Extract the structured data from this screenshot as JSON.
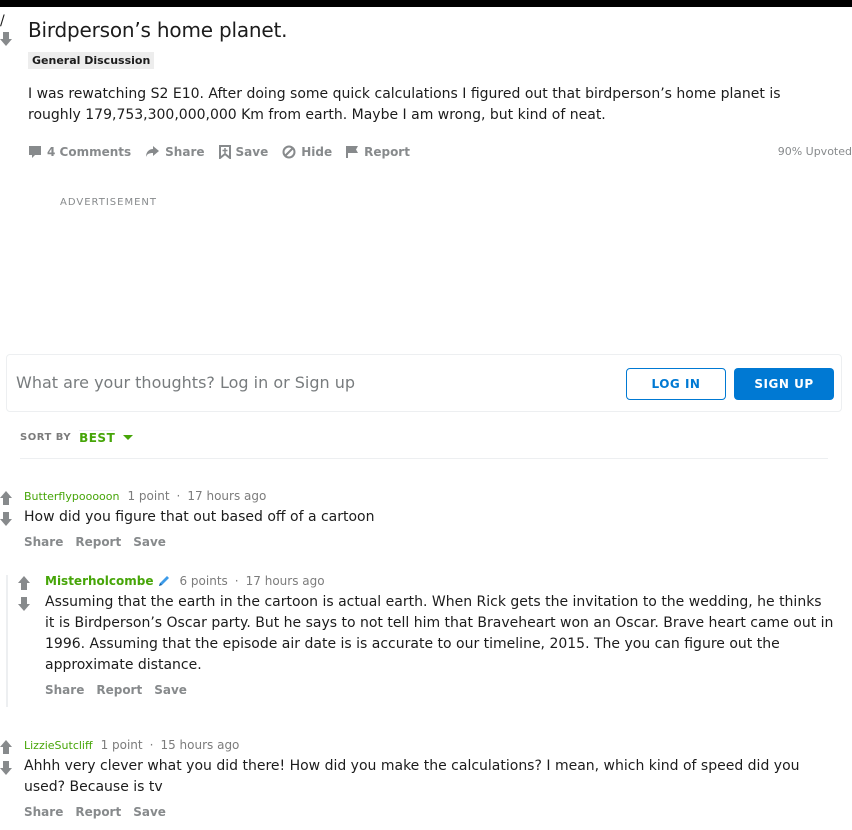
{
  "post": {
    "title": "Birdperson’s home planet.",
    "flair": "General Discussion",
    "body": "I was rewatching S2 E10. After doing some quick calculations I figured out that birdperson’s home planet is roughly 179,753,300,000,000 Km from earth. Maybe I am wrong, but kind of neat.",
    "actions": {
      "comments": "4 Comments",
      "share": "Share",
      "save": "Save",
      "hide": "Hide",
      "report": "Report"
    },
    "upvoted": "90% Upvoted"
  },
  "ad_label": "ADVERTISEMENT",
  "comment_box": {
    "placeholder": "What are your thoughts? Log in or Sign up",
    "login_label": "LOG IN",
    "signup_label": "SIGN UP"
  },
  "sort": {
    "label": "SORT BY",
    "value": "BEST"
  },
  "comments": [
    {
      "author": "Butterflypooooon",
      "points": "1 point",
      "time": "17 hours ago",
      "text": "How did you figure that out based off of a cartoon",
      "actions": [
        "Share",
        "Report",
        "Save"
      ]
    },
    {
      "author": "Misterholcombe",
      "points": "6 points",
      "time": "17 hours ago",
      "text": "Assuming that the earth in the cartoon is actual earth. When Rick gets the invitation to the wedding, he thinks it is Birdperson’s Oscar party. But he says to not tell him that Braveheart won an Oscar. Brave heart came out in 1996. Assuming that the episode air date is is accurate to our timeline, 2015. The you can figure out the approximate distance.",
      "actions": [
        "Share",
        "Report",
        "Save"
      ]
    },
    {
      "author": "LizzieSutcliff",
      "points": "1 point",
      "time": "15 hours ago",
      "text": "Ahhh very clever what you did there! How did you make the calculations? I mean, which kind of speed did you used? Because is tv",
      "actions": [
        "Share",
        "Report",
        "Save"
      ]
    }
  ],
  "colors": {
    "accent_blue": "#0079d3",
    "author_green": "#46a508",
    "meta_gray": "#878a8c"
  }
}
